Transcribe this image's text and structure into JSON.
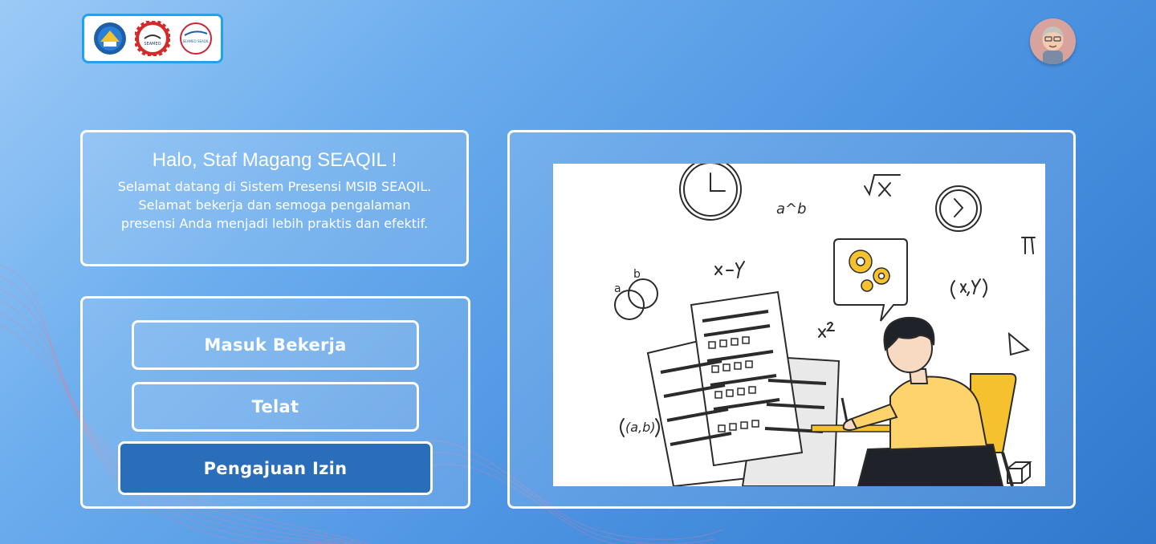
{
  "header": {
    "logos": [
      "kemendikbud-logo",
      "seameo-logo",
      "seameo-seaqil-logo"
    ],
    "seameo_logo_text": "SEAMEO",
    "seaqil_logo_text": "SEAMEO SEAQIL",
    "avatar": "user-avatar"
  },
  "welcome": {
    "title": "Halo, Staf Magang SEAQIL !",
    "message": "Selamat datang di Sistem Presensi MSIB SEAQIL. Selamat bekerja dan semoga pengalaman presensi Anda menjadi lebih praktis dan efektif."
  },
  "actions": {
    "check_in_label": "Masuk Bekerja",
    "late_label": "Telat",
    "leave_request_label": "Pengajuan Izin"
  },
  "illustration": {
    "image": "student-studying-math-illustration",
    "doodles": [
      "a^b",
      "√x",
      "x-y",
      "x²",
      "(x,y)",
      "(a,b)",
      "π",
      "a",
      "b"
    ]
  },
  "colors": {
    "background_start": "#9ccaf7",
    "background_end": "#2f78cd",
    "logo_border": "#1ea3f0",
    "primary_button": "#2a6db8",
    "accent_yellow": "#f5c12e"
  }
}
